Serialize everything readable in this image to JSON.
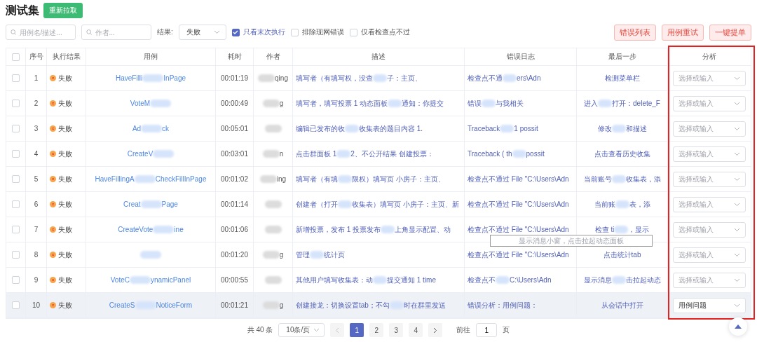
{
  "title": "测试集",
  "refetch_button": "重新拉取",
  "filters": {
    "case_search": {
      "placeholder": "用例名/描述..."
    },
    "author_search": {
      "placeholder": "作者..."
    },
    "result_label": "结果:",
    "result_select": {
      "value": "失败"
    },
    "checks": [
      {
        "label": "只看末次执行",
        "checked": true
      },
      {
        "label": "排除现网错误",
        "checked": false
      },
      {
        "label": "仅看检查点不过",
        "checked": false
      }
    ]
  },
  "actions": [
    "错误列表",
    "用例重试",
    "一键提单"
  ],
  "columns": [
    {
      "kind": "check",
      "checked": false
    },
    {
      "label": "序号",
      "kind": "seq"
    },
    {
      "label": "执行结果",
      "kind": "result"
    },
    {
      "label": "用例",
      "kind": "case"
    },
    {
      "label": "耗时",
      "kind": "time"
    },
    {
      "label": "作者",
      "kind": "author"
    },
    {
      "label": "描述",
      "kind": "desc"
    },
    {
      "label": "错误日志",
      "kind": "log"
    },
    {
      "label": "最后一步",
      "kind": "last"
    },
    {
      "label": "分析",
      "kind": "analysis"
    }
  ],
  "analysis_column_framed": true,
  "rows": [
    {
      "checked": false,
      "seq": "1",
      "failed": true,
      "result": "失败",
      "case": {
        "parts": [
          "HaveFilli",
          "InPage"
        ]
      },
      "time": "00:01:19",
      "author": {
        "parts": [
          "qing"
        ],
        "blur_before": true
      },
      "desc": {
        "parts": [
          "填写者（有填写权，没查",
          "子：主页、"
        ]
      },
      "log": {
        "parts": [
          "检查点不通",
          "ers\\Adn"
        ]
      },
      "last": {
        "parts": [
          "检测菜单栏"
        ]
      },
      "analysis": {
        "placeholder": "选择或输入"
      },
      "selected": false
    },
    {
      "checked": false,
      "seq": "2",
      "failed": true,
      "result": "失败",
      "case": {
        "parts": [
          "VoteM"
        ],
        "blur_after": true
      },
      "time": "00:00:49",
      "author": {
        "parts": [
          "g"
        ],
        "blur_before": true
      },
      "desc": {
        "parts": [
          "填写者，填写投票 1 动态面板",
          "通知：你提交"
        ]
      },
      "log": {
        "parts": [
          "错误",
          "与我相关"
        ]
      },
      "last": {
        "parts": [
          "进入",
          "打开：delete_F"
        ]
      },
      "analysis": {
        "placeholder": "选择或输入"
      },
      "selected": false
    },
    {
      "checked": false,
      "seq": "3",
      "failed": true,
      "result": "失败",
      "case": {
        "parts": [
          "Ad",
          "ck"
        ]
      },
      "time": "00:05:01",
      "author": {
        "blur_before": true
      },
      "desc": {
        "parts": [
          "编辑已发布的收",
          "收集表的题目内容 1."
        ]
      },
      "log": {
        "parts": [
          "Traceback",
          "1 possit"
        ]
      },
      "last": {
        "parts": [
          "修改",
          "和描述"
        ]
      },
      "analysis": {
        "placeholder": "选择或输入"
      },
      "selected": false
    },
    {
      "checked": false,
      "seq": "4",
      "failed": true,
      "result": "失败",
      "case": {
        "parts": [
          "CreateV"
        ],
        "blur_after": true
      },
      "time": "00:03:01",
      "author": {
        "parts": [
          "n"
        ],
        "blur_before": true
      },
      "desc": {
        "parts": [
          "点击群面板 1",
          "2、不公开结果 创建投票："
        ]
      },
      "log": {
        "parts": [
          "Traceback ( th",
          "possit"
        ]
      },
      "last": {
        "parts": [
          "点击查看历史收集"
        ]
      },
      "analysis": {
        "placeholder": "选择或输入"
      },
      "selected": false
    },
    {
      "checked": false,
      "seq": "5",
      "failed": true,
      "result": "失败",
      "case": {
        "parts": [
          "HaveFillingA",
          "CheckFillInPage"
        ]
      },
      "time": "00:01:02",
      "author": {
        "parts": [
          "ing"
        ],
        "blur_before": true
      },
      "desc": {
        "parts": [
          "填写者（有填",
          "限权）填写页 小房子：主页、"
        ]
      },
      "log": {
        "parts": [
          "检查点不通过 File \"C:\\Users\\Adn"
        ]
      },
      "last": {
        "parts": [
          "当前账号",
          "收集表，添"
        ]
      },
      "analysis": {
        "placeholder": "选择或输入"
      },
      "selected": false
    },
    {
      "checked": false,
      "seq": "6",
      "failed": true,
      "result": "失败",
      "case": {
        "parts": [
          "Creat",
          "Page"
        ]
      },
      "time": "00:01:14",
      "author": {
        "blur_before": true
      },
      "desc": {
        "parts": [
          "创建者（打开",
          "收集表）填写页 小房子：主页、新"
        ]
      },
      "log": {
        "parts": [
          "检查点不通过 File \"C:\\Users\\Adn"
        ]
      },
      "last": {
        "parts": [
          "当前账",
          "表，添"
        ]
      },
      "analysis": {
        "placeholder": "选择或输入"
      },
      "selected": false
    },
    {
      "checked": false,
      "seq": "7",
      "failed": true,
      "result": "失败",
      "case": {
        "parts": [
          "CreateVote",
          "ine"
        ]
      },
      "time": "00:01:06",
      "author": {
        "blur_before": true
      },
      "desc": {
        "parts": [
          "新增投票，发布 1 投票发布",
          "上角显示配置、动"
        ]
      },
      "log": {
        "parts": [
          "检查点不通过 File \"C:\\Users\\Adn"
        ]
      },
      "last": {
        "parts": [
          "检查 ti",
          "，显示"
        ]
      },
      "analysis": {
        "placeholder": "选择或输入"
      },
      "selected": false
    },
    {
      "checked": false,
      "seq": "8",
      "failed": true,
      "result": "失败",
      "case": {
        "blur_before": true
      },
      "time": "00:01:20",
      "author": {
        "parts": [
          "g"
        ],
        "blur_before": true
      },
      "desc": {
        "parts": [
          "管理",
          "统计页"
        ]
      },
      "log": {
        "parts": [
          "检查点不通过 File \"C:\\Users\\Adn"
        ]
      },
      "last": {
        "parts": [
          "点击统计tab"
        ]
      },
      "analysis": {
        "placeholder": "选择或输入"
      },
      "selected": false
    },
    {
      "checked": false,
      "seq": "9",
      "failed": true,
      "result": "失败",
      "case": {
        "parts": [
          "VoteC",
          "ynamicPanel"
        ]
      },
      "time": "00:00:55",
      "author": {
        "blur_before": true
      },
      "desc": {
        "parts": [
          "其他用户填写收集表：动",
          "提交通知 1 time"
        ]
      },
      "log": {
        "parts": [
          "检查点不",
          "C:\\Users\\Adn"
        ]
      },
      "last": {
        "parts": [
          "显示消息",
          "击拉起动态"
        ]
      },
      "analysis": {
        "placeholder": "选择或输入"
      },
      "selected": false
    },
    {
      "checked": false,
      "seq": "10",
      "failed": true,
      "result": "失败",
      "case": {
        "parts": [
          "CreateS",
          "NoticeForm"
        ]
      },
      "time": "00:01:21",
      "author": {
        "parts": [
          "g"
        ],
        "blur_before": true
      },
      "desc": {
        "parts": [
          "创建接龙：切换设置tab；不勾",
          "时在群里发送"
        ]
      },
      "log": {
        "parts": [
          "错误分析：用例问题："
        ]
      },
      "last": {
        "parts": [
          "从会话中打开"
        ]
      },
      "analysis": {
        "value": "用例问题"
      },
      "selected": true
    }
  ],
  "tooltip": {
    "text": "显示消息小窗，点击拉起动态面板"
  },
  "pagination": {
    "total": "共 40 条",
    "page_size": "10条/页",
    "prev_disabled": true,
    "pages": [
      {
        "label": "1",
        "selected": true
      },
      {
        "label": "2",
        "selected": false
      },
      {
        "label": "3",
        "selected": false
      },
      {
        "label": "4",
        "selected": false
      }
    ],
    "goto_label": "前往",
    "goto_value": "1",
    "goto_suffix": "页"
  }
}
